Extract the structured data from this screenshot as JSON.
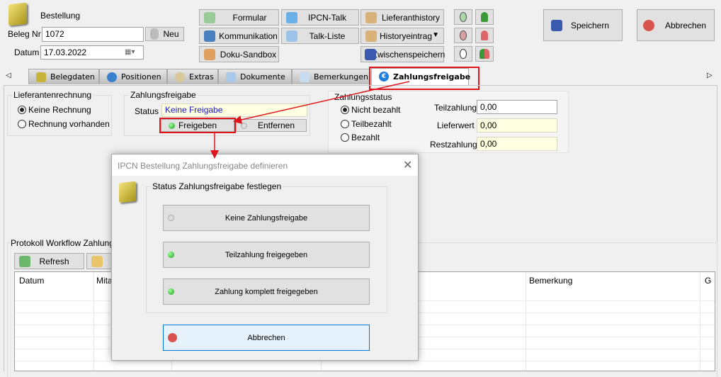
{
  "header": {
    "title": "Bestellung",
    "beleg_label": "Beleg Nr",
    "beleg_value": "1072",
    "neu_label": "Neu",
    "datum_label": "Datum",
    "datum_value": "17.03.2022"
  },
  "toolbar": {
    "formular": "Formular",
    "ipcn_talk": "IPCN-Talk",
    "lieferanthistory": "Lieferanthistory",
    "kommunikation": "Kommunikation",
    "talk_liste": "Talk-Liste",
    "historyeintrag": "Historyeintrag",
    "doku_sandbox": "Doku-Sandbox",
    "zwischenspeichern": "Zwischenspeichern",
    "speichern": "Speichern",
    "abbrechen": "Abbrechen"
  },
  "tabs": [
    {
      "label": "Belegdaten"
    },
    {
      "label": "Positionen"
    },
    {
      "label": "Extras"
    },
    {
      "label": "Dokumente"
    },
    {
      "label": "Bemerkungen"
    },
    {
      "label": "Zahlungsfreigabe",
      "active": true
    }
  ],
  "lieferantenrechnung": {
    "title": "Lieferantenrechnung",
    "options": [
      "Keine Rechnung",
      "Rechnung vorhanden"
    ],
    "selected": "Keine Rechnung"
  },
  "zahlungsfreigabe": {
    "title": "Zahlungsfreigabe",
    "status_label": "Status",
    "status_value": "Keine Freigabe",
    "freigeben": "Freigeben",
    "entfernen": "Entfernen"
  },
  "zahlungsstatus": {
    "title": "Zahlungsstatus",
    "options": [
      "Nicht bezahlt",
      "Teilbezahlt",
      "Bezahlt"
    ],
    "selected": "Nicht bezahlt",
    "teilzahlung_label": "Teilzahlung",
    "teilzahlung": "0,00",
    "lieferwert_label": "Lieferwert",
    "lieferwert": "0,00",
    "restzahlung_label": "Restzahlung",
    "restzahlung": "0,00"
  },
  "protokoll": {
    "title": "Protokoll Workflow Zahlungsfr",
    "refresh": "Refresh",
    "columns": [
      "Datum",
      "Mitar",
      "",
      "",
      "Bemerkung",
      "G"
    ]
  },
  "dialog": {
    "title": "IPCN  Bestellung Zahlungsfreigabe definieren",
    "group_title": "Status Zahlungsfreigabe festlegen",
    "options": [
      "Keine Zahlungsfreigabe",
      "Teilzahlung freigegeben",
      "Zahlung komplett freigegeben"
    ],
    "cancel": "Abbrechen"
  },
  "colors": {
    "highlight": "#e0141b",
    "accent": "#0078d7"
  }
}
